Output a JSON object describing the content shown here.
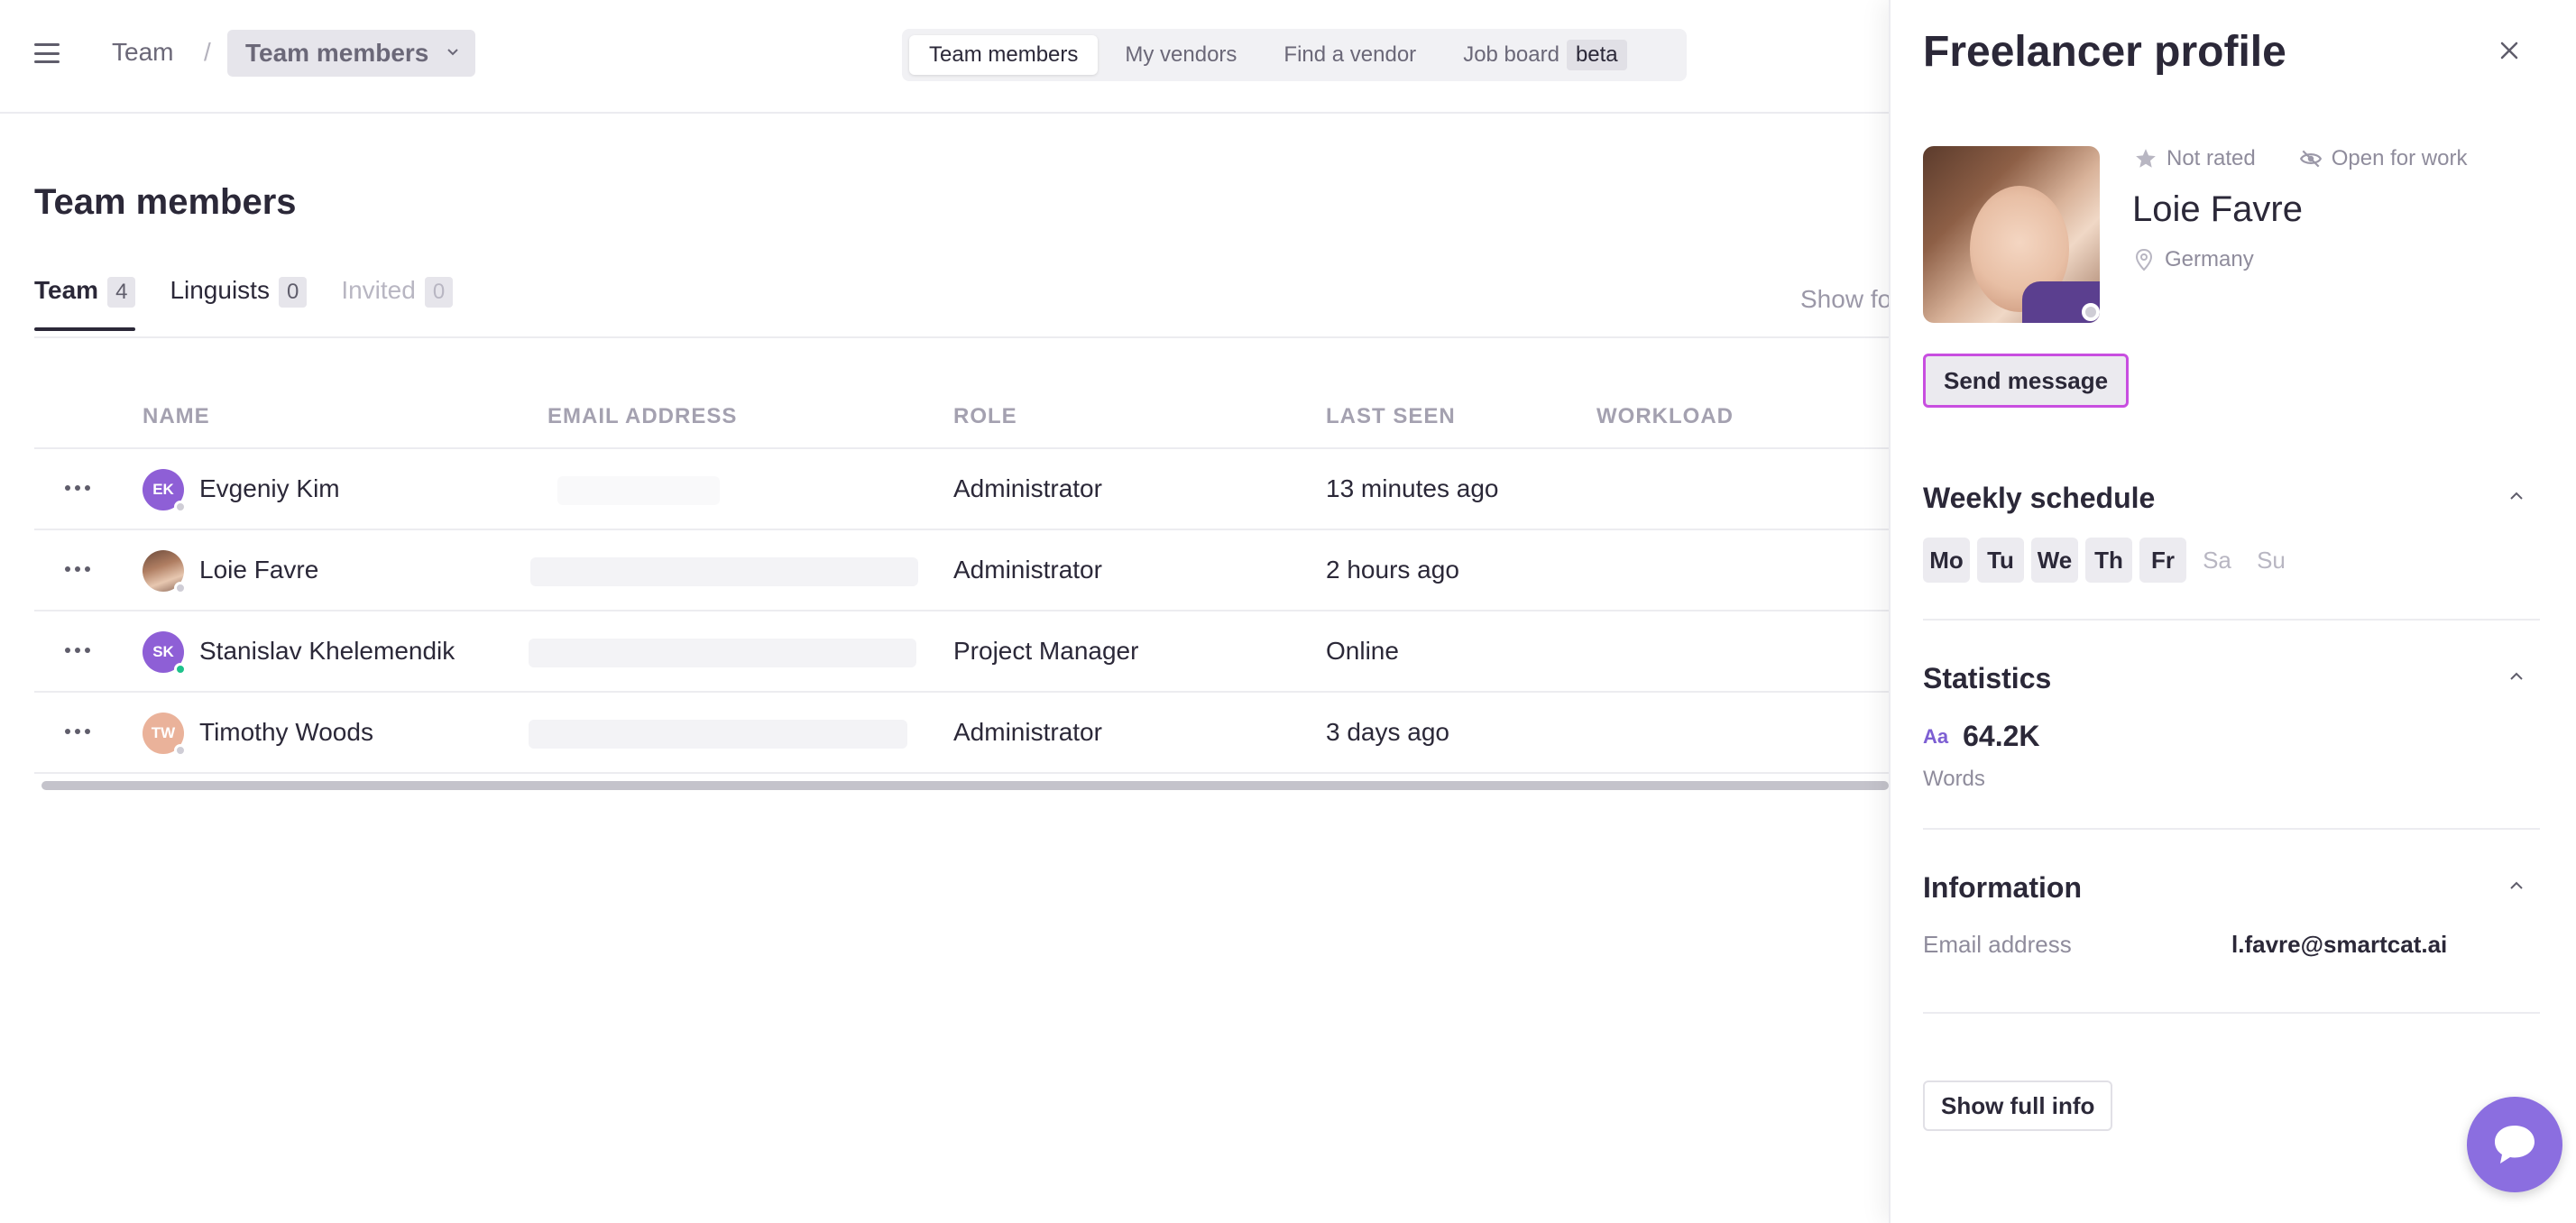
{
  "breadcrumb": {
    "root": "Team",
    "separator": "/",
    "current": "Team members"
  },
  "topnav": {
    "tabs": [
      "Team members",
      "My vendors",
      "Find a vendor",
      "Job board"
    ],
    "badge": "beta"
  },
  "page": {
    "title": "Team members",
    "show_for": "Show fo"
  },
  "subtabs": [
    {
      "label": "Team",
      "count": "4"
    },
    {
      "label": "Linguists",
      "count": "0"
    },
    {
      "label": "Invited",
      "count": "0"
    }
  ],
  "table": {
    "columns": [
      "NAME",
      "EMAIL ADDRESS",
      "ROLE",
      "LAST SEEN",
      "WORKLOAD"
    ],
    "rows": [
      {
        "initials": "EK",
        "name": "Evgeniy Kim",
        "role": "Administrator",
        "last_seen": "13 minutes ago",
        "avatar_color": "#8e5fd6",
        "status": "offline"
      },
      {
        "initials": "",
        "name": "Loie Favre",
        "role": "Administrator",
        "last_seen": "2 hours ago",
        "avatar_color": "photo",
        "status": "offline"
      },
      {
        "initials": "SK",
        "name": "Stanislav Khelemendik",
        "role": "Project Manager",
        "last_seen": "Online",
        "avatar_color": "#8e5fd6",
        "status": "online"
      },
      {
        "initials": "TW",
        "name": "Timothy Woods",
        "role": "Administrator",
        "last_seen": "3 days ago",
        "avatar_color": "#eab29a",
        "status": "offline"
      }
    ]
  },
  "panel": {
    "title": "Freelancer profile",
    "rating": "Not rated",
    "availability": "Open for work",
    "name": "Loie Favre",
    "location": "Germany",
    "send_message": "Send message",
    "weekly_schedule": {
      "title": "Weekly schedule",
      "days": [
        {
          "label": "Mo",
          "active": true
        },
        {
          "label": "Tu",
          "active": true
        },
        {
          "label": "We",
          "active": true
        },
        {
          "label": "Th",
          "active": true
        },
        {
          "label": "Fr",
          "active": true
        },
        {
          "label": "Sa",
          "active": false
        },
        {
          "label": "Su",
          "active": false
        }
      ]
    },
    "statistics": {
      "title": "Statistics",
      "icon_text": "Aa",
      "value": "64.2K",
      "label": "Words"
    },
    "information": {
      "title": "Information",
      "email_label": "Email address",
      "email_value": "l.favre@smartcat.ai"
    },
    "show_full_info": "Show full info"
  },
  "colors": {
    "accent": "#8b6ee0",
    "focus_outline": "#c84ee0",
    "online": "#1ec28b",
    "text": "#2b2838"
  }
}
